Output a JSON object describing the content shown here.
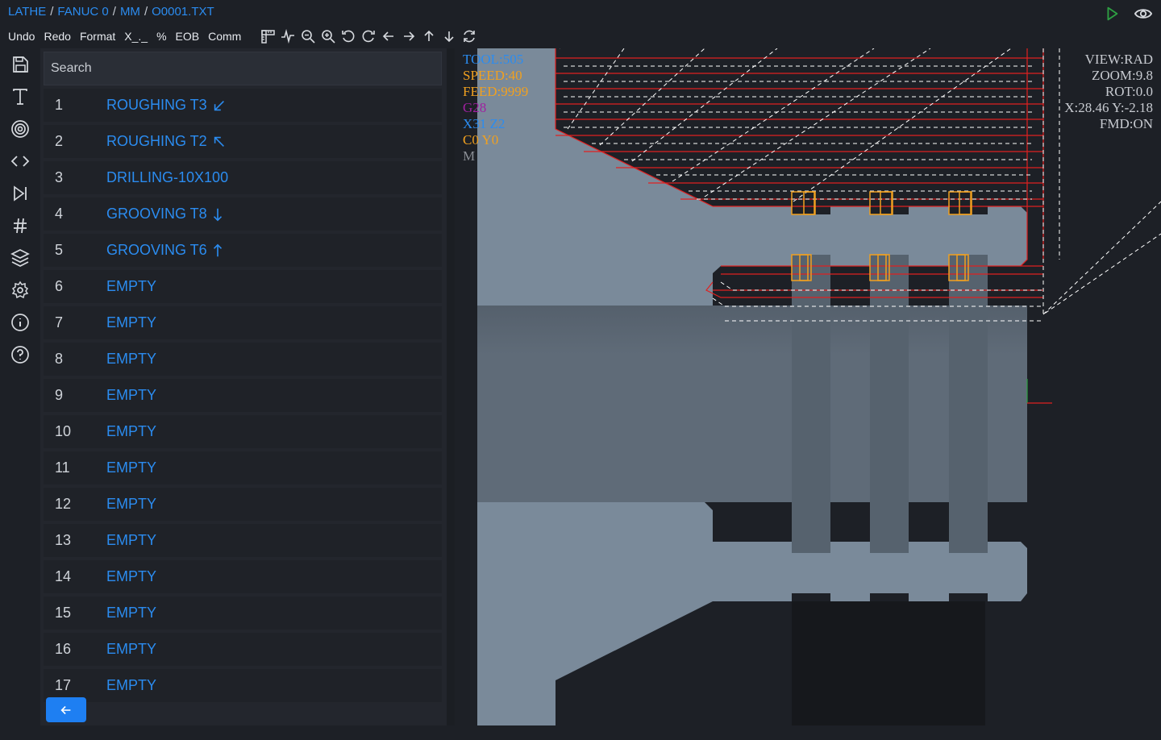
{
  "breadcrumb": [
    "LATHE",
    "FANUC 0",
    "MM",
    "O0001.TXT"
  ],
  "top_actions": [
    {
      "name": "play-icon",
      "color": "#2ea043"
    },
    {
      "name": "eye-icon",
      "color": "#d6d9de"
    }
  ],
  "toolbar": {
    "undo": "Undo",
    "redo": "Redo",
    "format": "Format",
    "xspace": "X_._",
    "percent": "%",
    "eob": "EOB",
    "comm": "Comm"
  },
  "toolbar_icons": [
    "ruler-icon",
    "waveform-icon",
    "zoom-out-icon",
    "zoom-in-icon",
    "rotate-left-icon",
    "rotate-right-icon",
    "arrow-left-icon",
    "arrow-right-icon",
    "arrow-up-icon",
    "arrow-down-icon",
    "refresh-icon"
  ],
  "sidebar_icons": [
    "save-icon",
    "text-icon",
    "target-icon",
    "code-icon",
    "skip-forward-icon",
    "hash-icon",
    "layers-icon",
    "gear-icon",
    "info-icon",
    "help-icon"
  ],
  "search": {
    "placeholder": "Search"
  },
  "operations": [
    {
      "num": "1",
      "label": "ROUGHING T3",
      "icon": "arrow-down-left-icon"
    },
    {
      "num": "2",
      "label": "ROUGHING T2",
      "icon": "arrow-up-left-icon"
    },
    {
      "num": "3",
      "label": "DRILLING-10X100",
      "icon": ""
    },
    {
      "num": "4",
      "label": "GROOVING T8",
      "icon": "arrow-down-icon"
    },
    {
      "num": "5",
      "label": "GROOVING T6",
      "icon": "arrow-up-icon"
    },
    {
      "num": "6",
      "label": "EMPTY",
      "icon": ""
    },
    {
      "num": "7",
      "label": "EMPTY",
      "icon": ""
    },
    {
      "num": "8",
      "label": "EMPTY",
      "icon": ""
    },
    {
      "num": "9",
      "label": "EMPTY",
      "icon": ""
    },
    {
      "num": "10",
      "label": "EMPTY",
      "icon": ""
    },
    {
      "num": "11",
      "label": "EMPTY",
      "icon": ""
    },
    {
      "num": "12",
      "label": "EMPTY",
      "icon": ""
    },
    {
      "num": "13",
      "label": "EMPTY",
      "icon": ""
    },
    {
      "num": "14",
      "label": "EMPTY",
      "icon": ""
    },
    {
      "num": "15",
      "label": "EMPTY",
      "icon": ""
    },
    {
      "num": "16",
      "label": "EMPTY",
      "icon": ""
    },
    {
      "num": "17",
      "label": "EMPTY",
      "icon": ""
    }
  ],
  "viewport": {
    "left_info": [
      {
        "text": "TOOL:505",
        "color": "#2b8cf0"
      },
      {
        "text": "SPEED:40",
        "color": "#f0a020"
      },
      {
        "text": "FEED:9999",
        "color": "#f0a020"
      },
      {
        "text": "G28",
        "color": "#a020a0"
      },
      {
        "text": "X31 Z2",
        "color": "#2b8cf0"
      },
      {
        "text": "C0 Y0",
        "color": "#f0a020"
      },
      {
        "text": "M",
        "color": "#8a8e95"
      }
    ],
    "right_info": [
      "VIEW:RAD",
      "ZOOM:9.8",
      "ROT:0.0",
      "X:28.46 Y:-2.18",
      "FMD:ON"
    ]
  },
  "colors": {
    "accent": "#2b8cf0",
    "toolpath": "#e02020",
    "part": "#7a8a9a",
    "rapid": "#ffffff",
    "tool": "#f0a020"
  }
}
